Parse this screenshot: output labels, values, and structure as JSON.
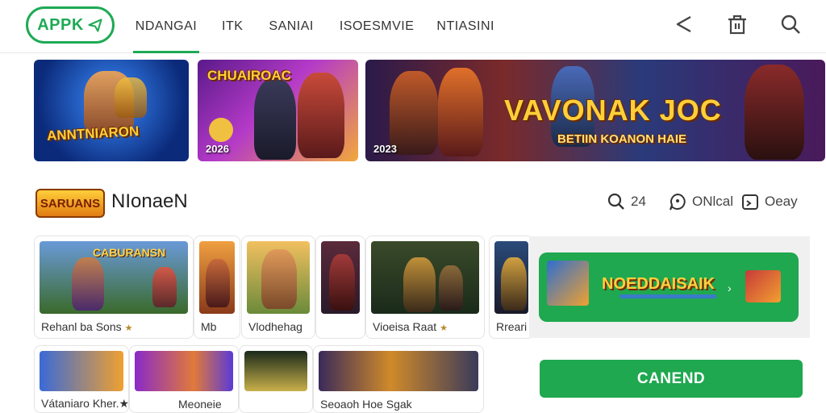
{
  "header": {
    "logo_text": "APPK",
    "nav": [
      "NDANGAI",
      "ITK",
      "SANIAI",
      "ISOESMVIE",
      "NTIASINI"
    ]
  },
  "banners": [
    {
      "title": "ANNTNIARON",
      "year": ""
    },
    {
      "title": "CHUAIROAC",
      "year": "2026"
    },
    {
      "title": "VAVONAK JOC",
      "subtitle": "BETIIN KOANON HAIE",
      "year": "2023"
    }
  ],
  "section": {
    "logo_text": "SARUANS",
    "title": "NIonaeN",
    "stats": [
      {
        "icon": "search-icon",
        "value": "24"
      },
      {
        "icon": "chat-icon",
        "value": "ONlcal"
      },
      {
        "icon": "calendar-icon",
        "value": "Oeay"
      }
    ]
  },
  "games_row1": [
    {
      "thumb_text": "CABURANSN",
      "label": "Rehanl ba Sons"
    },
    {
      "thumb_text": "",
      "label": "Mb"
    },
    {
      "thumb_text": "",
      "label": "Vlodhehag"
    },
    {
      "thumb_text": "",
      "label": ""
    },
    {
      "thumb_text": "",
      "label": "Vioeisa Raat"
    },
    {
      "thumb_text": "",
      "label": "Rreari"
    }
  ],
  "games_row2": [
    {
      "label": "Vátaniaro Kher."
    },
    {
      "label": "Meoneie"
    },
    {
      "label": ""
    },
    {
      "label": "Seoaoh Hoe Sgak"
    }
  ],
  "promo": {
    "text": "NOEDDAISAIK"
  },
  "cta": {
    "label": "CANEND"
  },
  "colors": {
    "accent": "#1fa84f",
    "logo": "#1eaa55"
  }
}
